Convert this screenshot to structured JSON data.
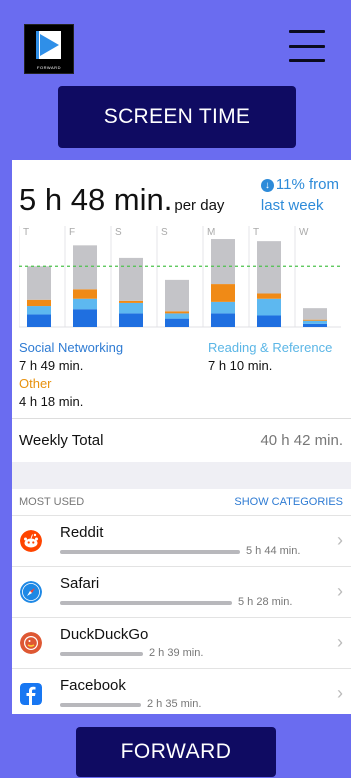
{
  "header": {
    "logo_text": "FORWARD",
    "screen_time_label": "SCREEN TIME"
  },
  "summary": {
    "big_time": "5 h 48 min.",
    "per_day": "per day",
    "delta_line1": "11% from",
    "delta_line2": "last week",
    "delta_arrow": "↓"
  },
  "chart_data": {
    "type": "bar",
    "categories": [
      "T",
      "F",
      "S",
      "S",
      "M",
      "T",
      "W"
    ],
    "stacked": true,
    "average_line": 5.8,
    "series": [
      {
        "name": "Social Networking",
        "color": "#1f6fe0",
        "values": [
          1.2,
          1.7,
          1.3,
          0.8,
          1.3,
          1.1,
          0.3
        ]
      },
      {
        "name": "Reading & Reference",
        "color": "#5db8f0",
        "values": [
          0.8,
          1.0,
          1.0,
          0.5,
          1.1,
          1.6,
          0.3
        ]
      },
      {
        "name": "Other",
        "color": "#f08a16",
        "values": [
          0.6,
          0.9,
          0.2,
          0.2,
          1.7,
          0.5,
          0.1
        ]
      },
      {
        "name": "",
        "color": "#c4c4c8",
        "values": [
          3.2,
          4.2,
          4.1,
          3.0,
          4.3,
          5.0,
          1.1
        ]
      }
    ]
  },
  "legend": {
    "social_label": "Social Networking",
    "social_value": "7 h 49 min.",
    "reading_label": "Reading & Reference",
    "reading_value": "7 h 10 min.",
    "other_label": "Other",
    "other_value": "4 h 18 min."
  },
  "weekly": {
    "label": "Weekly Total",
    "value": "40 h 42 min."
  },
  "most_used": {
    "title": "MOST USED",
    "show_categories": "SHOW CATEGORIES",
    "apps": [
      {
        "name": "Reddit",
        "time": "5 h 44 min.",
        "icon": "reddit-icon",
        "fraction": 1.0
      },
      {
        "name": "Safari",
        "time": "5 h 28 min.",
        "icon": "safari-icon",
        "fraction": 0.953
      },
      {
        "name": "DuckDuckGo",
        "time": "2 h 39 min.",
        "icon": "duckduckgo-icon",
        "fraction": 0.462
      },
      {
        "name": "Facebook",
        "time": "2 h 35 min.",
        "icon": "facebook-icon",
        "fraction": 0.45
      }
    ]
  },
  "footer": {
    "forward_label": "FORWARD"
  }
}
